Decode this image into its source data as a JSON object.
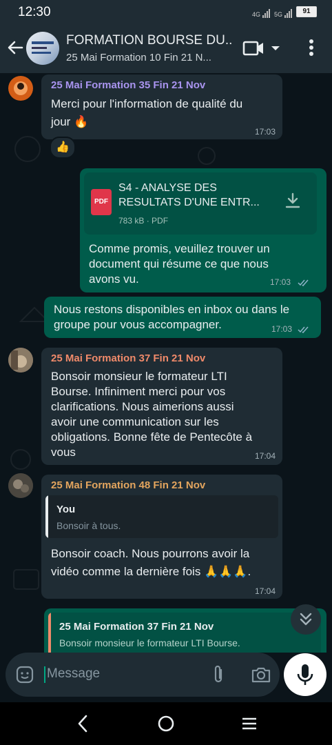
{
  "status_bar": {
    "time": "12:30",
    "signal_1": "4G",
    "signal_2": "5G",
    "battery": "91"
  },
  "header": {
    "title": "FORMATION BOURSE DU...",
    "subtitle": "25 Mai Formation 10 Fin 21 N..."
  },
  "messages": [
    {
      "sender": "25 Mai Formation 35 Fin 21 Nov",
      "sender_color": "#a994ef",
      "text_line1": "Merci pour l'information de qualité du",
      "text_line2": "jour 🔥",
      "time": "17:03",
      "reaction": "👍"
    },
    {
      "file_title_line1": "S4 - ANALYSE DES",
      "file_title_line2": "RESULTATS D'UNE ENTR...",
      "file_meta": "783 kB · PDF",
      "file_badge": "PDF",
      "text_line1": "Comme promis, veuillez trouver un",
      "text_line2": "document qui résume ce que nous",
      "text_line3": "avons vu.",
      "time": "17:03"
    },
    {
      "text_line1": "Nous restons disponibles en inbox ou dans le",
      "text_line2": "groupe pour vous accompagner.",
      "time": "17:03"
    },
    {
      "sender": "25 Mai Formation 37 Fin 21 Nov",
      "sender_color": "#f08a6a",
      "text_line1": "Bonsoir monsieur le formateur LTI",
      "text_line2": "Bourse. Infiniment merci pour vos",
      "text_line3": "clarifications. Nous aimerions aussi",
      "text_line4": "avoir une communication sur les",
      "text_line5": "obligations. Bonne fête de Pentecôte à",
      "text_line6": "vous",
      "time": "17:04"
    },
    {
      "sender": "25 Mai Formation 48 Fin 21 Nov",
      "sender_color": "#e3a55e",
      "quote_author": "You",
      "quote_text": "Bonsoir à tous.",
      "text_line1": "Bonsoir coach. Nous pourrons avoir la",
      "text_line2": "vidéo comme la dernière fois 🙏🙏🙏.",
      "time": "17:04"
    },
    {
      "quote_author": "25 Mai Formation 37 Fin 21 Nov",
      "quote_text": "Bonsoir monsieur le formateur LTI Bourse."
    }
  ],
  "input": {
    "placeholder": "Message"
  },
  "colors": {
    "header_bg": "#1f2c34",
    "chat_bg": "#0b141a",
    "incoming_bubble": "#1f2c34",
    "outgoing_bubble": "#005c4b",
    "read_ticks": "#8fb4c9"
  }
}
